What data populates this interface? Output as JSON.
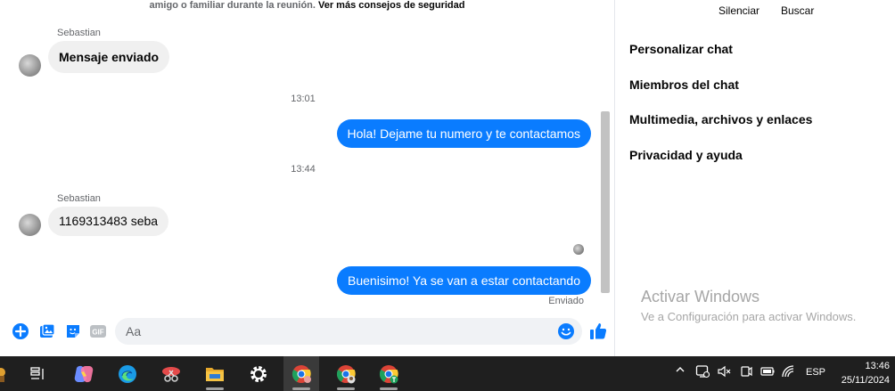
{
  "chat": {
    "notice": {
      "text": "amigo o familiar durante la reunión.",
      "link": "Ver más consejos de seguridad"
    },
    "messages": [
      {
        "sender": "Sebastian",
        "text": "Mensaje enviado"
      },
      {
        "time": "13:01"
      },
      {
        "text": "Hola! Dejame tu numero y te contactamos"
      },
      {
        "time": "13:44"
      },
      {
        "sender": "Sebastian",
        "text": "1169313483 seba"
      },
      {
        "text": "Buenisimo! Ya se van a estar contactando"
      }
    ],
    "status": "Enviado",
    "composer": {
      "placeholder": "Aa",
      "gif_label": "GIF"
    }
  },
  "side": {
    "actions": [
      "Silenciar",
      "Buscar"
    ],
    "items": [
      "Personalizar chat",
      "Miembros del chat",
      "Multimedia, archivos y enlaces",
      "Privacidad y ayuda"
    ]
  },
  "watermark": {
    "title": "Activar Windows",
    "subtitle": "Ve a Configuración para activar Windows."
  },
  "taskbar": {
    "icons": [
      "task-view-icon",
      "copilot-icon",
      "edge-icon",
      "snipping-icon",
      "file-explorer-icon",
      "settings-icon",
      "chrome-icon",
      "chrome-icon",
      "chrome-icon"
    ],
    "language": "ESP",
    "time": "13:46",
    "date": "25/11/2024"
  },
  "colors": {
    "accent": "#0a7cff",
    "incoming_bubble": "#f0f0f0",
    "taskbar": "#1f1f1f"
  }
}
